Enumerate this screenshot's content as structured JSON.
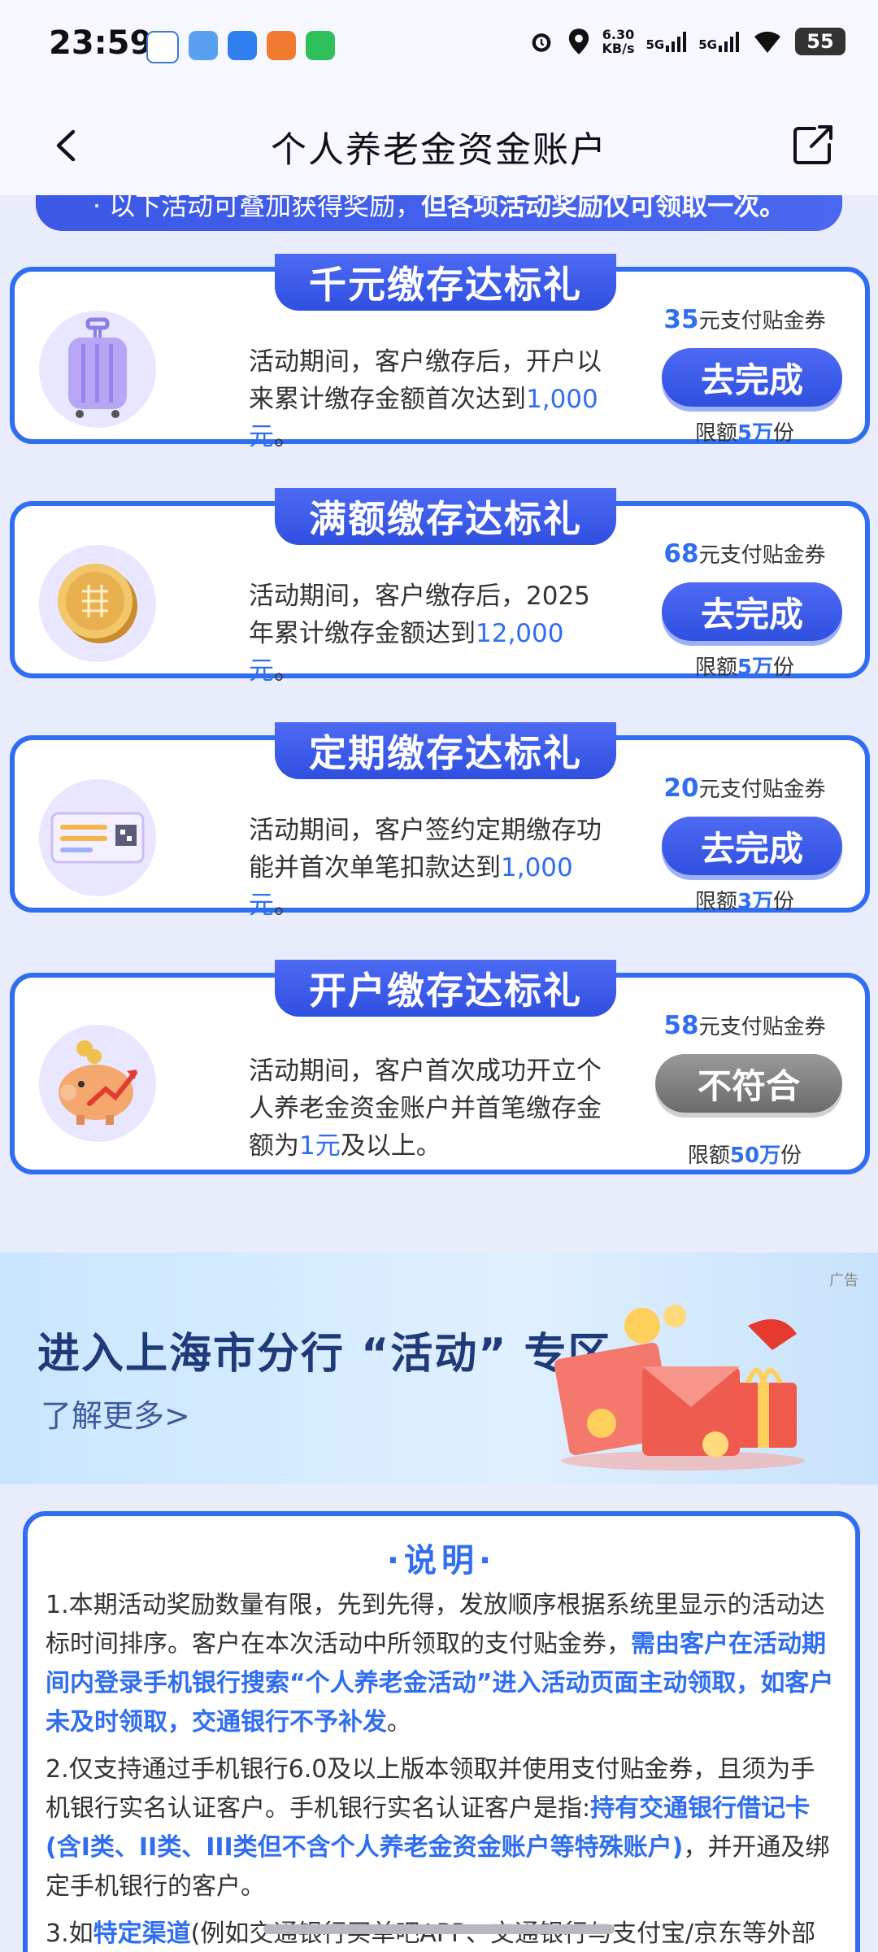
{
  "status_bar": {
    "time": "23:59",
    "net_speed_value": "6.30",
    "net_speed_unit": "KB/s",
    "signal1": "5G",
    "signal2": "5G",
    "battery": "55"
  },
  "header": {
    "title": "个人养老金资金账户"
  },
  "notice": {
    "text_normal": "· 以下活动可叠加获得奖励，",
    "text_bold": "但各项活动奖励仅可领取一次。"
  },
  "cards": [
    {
      "title": "千元缴存达标礼",
      "desc_pre": "活动期间，客户缴存后，开户以来累计缴存金额首次达到",
      "desc_hl": "1,000元",
      "desc_post": "。",
      "reward_num": "35",
      "reward_text": "元支付贴金券",
      "button": "去完成",
      "quota_pre": "限额",
      "quota_num": "5万",
      "quota_post": "份"
    },
    {
      "title": "满额缴存达标礼",
      "desc_pre": "活动期间，客户缴存后，2025年累计缴存金额达到",
      "desc_hl": "12,000元",
      "desc_post": "。",
      "reward_num": "68",
      "reward_text": "元支付贴金券",
      "button": "去完成",
      "quota_pre": "限额",
      "quota_num": "5万",
      "quota_post": "份"
    },
    {
      "title": "定期缴存达标礼",
      "desc_pre": "活动期间，客户签约定期缴存功能并首次单笔扣款达到",
      "desc_hl": "1,000元",
      "desc_post": "。",
      "reward_num": "20",
      "reward_text": "元支付贴金券",
      "button": "去完成",
      "quota_pre": "限额",
      "quota_num": "3万",
      "quota_post": "份"
    },
    {
      "title": "开户缴存达标礼",
      "desc_pre": "活动期间，客户首次成功开立个人养老金资金账户并首笔缴存金额为",
      "desc_hl": "1元",
      "desc_post": "及以上。",
      "reward_num": "58",
      "reward_text": "元支付贴金券",
      "button": "不符合",
      "quota_pre": "限额",
      "quota_num": "50万",
      "quota_post": "份"
    }
  ],
  "banner": {
    "ad_tag": "广告",
    "title": "进入上海市分行 “活动” 专区",
    "subtitle": "了解更多>"
  },
  "explain": {
    "title": "·说明·",
    "p1_normal": "1.本期活动奖励数量有限，先到先得，发放顺序根据系统里显示的活动达标时间排序。客户在本次活动中所领取的支付贴金券，",
    "p1_hl": "需由客户在活动期间内登录手机银行搜索“个人养老金活动”进入活动页面主动领取，如客户未及时领取，交通银行不予补发",
    "p1_end": "。",
    "p2_normal": "2.仅支持通过手机银行6.0及以上版本领取并使用支付贴金券，且须为手机银行实名认证客户。手机银行实名认证客户是指:",
    "p2_hl": "持有交通银行借记卡(含I类、II类、III类但不含个人养老金资金账户等特殊账户)",
    "p2_end": "，并开通及绑定手机银行的客户。",
    "p3_pre": "3.如",
    "p3_hl": "特定渠道",
    "p3_post": "(例如交通银行买单吧APP、交通银行与支付宝/京东等外部"
  }
}
